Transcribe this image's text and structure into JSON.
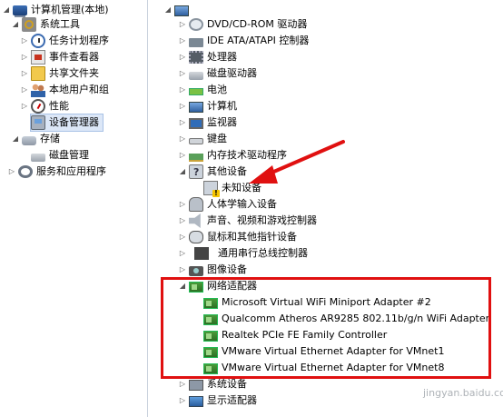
{
  "left_tree": {
    "root": "计算机管理(本地)",
    "system_tools": "系统工具",
    "task_scheduler": "任务计划程序",
    "event_viewer": "事件查看器",
    "shared_folders": "共享文件夹",
    "local_users": "本地用户和组",
    "performance": "性能",
    "device_manager": "设备管理器",
    "storage": "存储",
    "disk_management": "磁盘管理",
    "services_apps": "服务和应用程序"
  },
  "device_tree": {
    "dvd": "DVD/CD-ROM 驱动器",
    "ide": "IDE ATA/ATAPI 控制器",
    "processor": "处理器",
    "disk_drives": "磁盘驱动器",
    "battery": "电池",
    "computer": "计算机",
    "monitors": "监视器",
    "keyboards": "键盘",
    "memory_tech": "内存技术驱动程序",
    "other_devices": "其他设备",
    "unknown_device": "未知设备",
    "hid": "人体学输入设备",
    "sound": "声音、视频和游戏控制器",
    "mice": "鼠标和其他指针设备",
    "usb": "通用串行总线控制器",
    "imaging": "图像设备",
    "network_adapters": "网络适配器",
    "adapters": [
      "Microsoft Virtual WiFi Miniport Adapter #2",
      "Qualcomm Atheros AR9285 802.11b/g/n WiFi Adapter",
      "Realtek PCIe FE Family Controller",
      "VMware Virtual Ethernet Adapter for VMnet1",
      "VMware Virtual Ethernet Adapter for VMnet8"
    ],
    "system_devices": "系统设备",
    "display_adapters": "显示适配器"
  },
  "watermark": "jingyan.baidu.com",
  "colors": {
    "highlight_border": "#e01010",
    "arrow": "#e01010",
    "selection": "#dce7f7"
  }
}
